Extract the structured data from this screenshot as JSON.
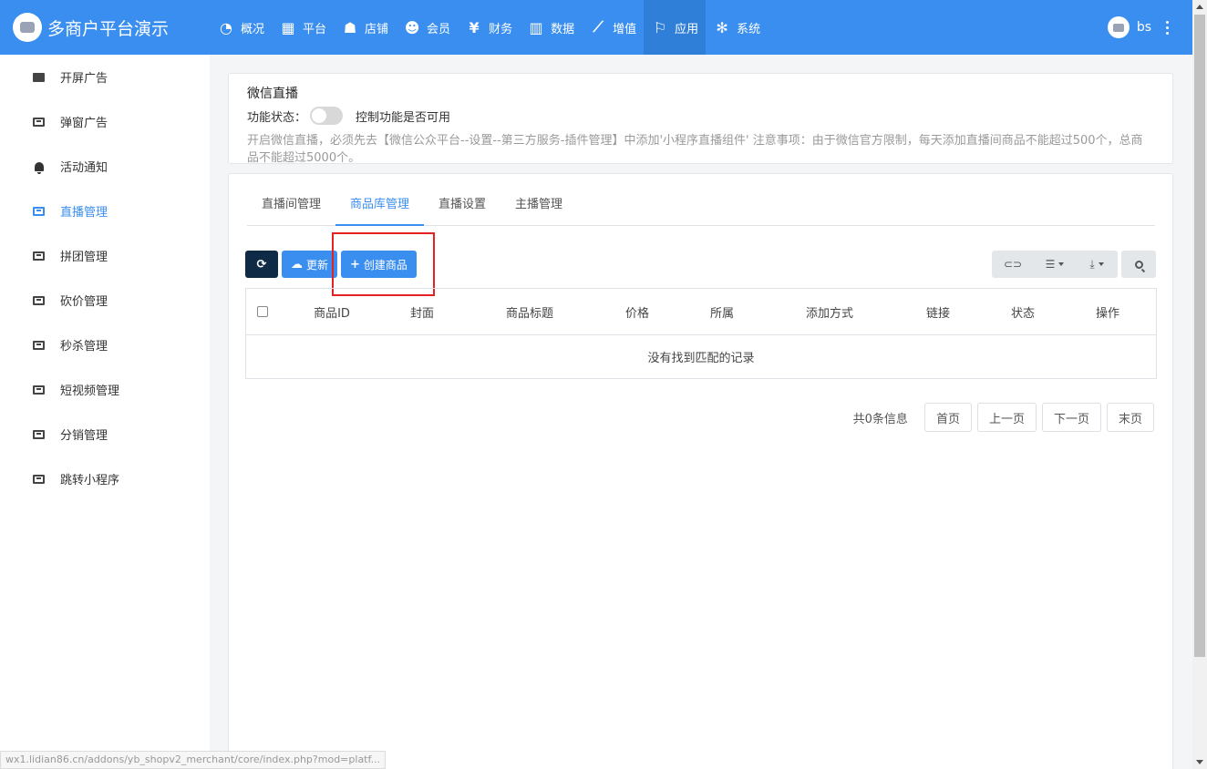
{
  "header": {
    "brand_title": "多商户平台演示",
    "user_name": "bs",
    "nav": [
      {
        "label": "概况",
        "icon": "dashboard-icon"
      },
      {
        "label": "平台",
        "icon": "grid-icon"
      },
      {
        "label": "店铺",
        "icon": "users-icon"
      },
      {
        "label": "会员",
        "icon": "user-plus-icon"
      },
      {
        "label": "财务",
        "icon": "yen-icon"
      },
      {
        "label": "数据",
        "icon": "bar-chart-icon"
      },
      {
        "label": "增值",
        "icon": "line-chart-icon"
      },
      {
        "label": "应用",
        "icon": "flag-icon",
        "active": true
      },
      {
        "label": "系统",
        "icon": "gear-icon"
      }
    ],
    "accent_color": "#3a8ef0"
  },
  "sidebar": {
    "items": [
      {
        "label": "开屏广告",
        "icon": "ad-icon"
      },
      {
        "label": "弹窗广告",
        "icon": "ad-icon"
      },
      {
        "label": "活动通知",
        "icon": "bell-icon"
      },
      {
        "label": "直播管理",
        "icon": "ad-icon",
        "active": true
      },
      {
        "label": "拼团管理",
        "icon": "ad-icon"
      },
      {
        "label": "砍价管理",
        "icon": "ad-icon"
      },
      {
        "label": "秒杀管理",
        "icon": "ad-icon"
      },
      {
        "label": "短视频管理",
        "icon": "ad-icon"
      },
      {
        "label": "分销管理",
        "icon": "ad-icon"
      },
      {
        "label": "跳转小程序",
        "icon": "ad-icon"
      }
    ]
  },
  "plugin_card": {
    "title": "微信直播",
    "status_label": "功能状态：",
    "toggle_on": false,
    "toggle_hint": "控制功能是否可用",
    "note": "开启微信直播，必须先去【微信公众平台--设置--第三方服务-插件管理】中添加'小程序直播组件' 注意事项：由于微信官方限制，每天添加直播间商品不能超过500个，总商品不能超过5000个。"
  },
  "tabs": [
    {
      "label": "直播间管理"
    },
    {
      "label": "商品库管理",
      "active": true
    },
    {
      "label": "直播设置"
    },
    {
      "label": "主播管理"
    }
  ],
  "toolbar": {
    "refresh_icon": "refresh-icon",
    "update_label": "更新",
    "create_label": "创建商品"
  },
  "table": {
    "columns": [
      "商品ID",
      "封面",
      "商品标题",
      "价格",
      "所属",
      "添加方式",
      "链接",
      "状态",
      "操作"
    ],
    "empty_text": "没有找到匹配的记录"
  },
  "pagination": {
    "info": "共0条信息",
    "first": "首页",
    "prev": "上一页",
    "next": "下一页",
    "last": "末页"
  },
  "status_bar": {
    "url": "wx1.lidian86.cn/addons/yb_shopv2_merchant/core/index.php?mod=platf..."
  }
}
